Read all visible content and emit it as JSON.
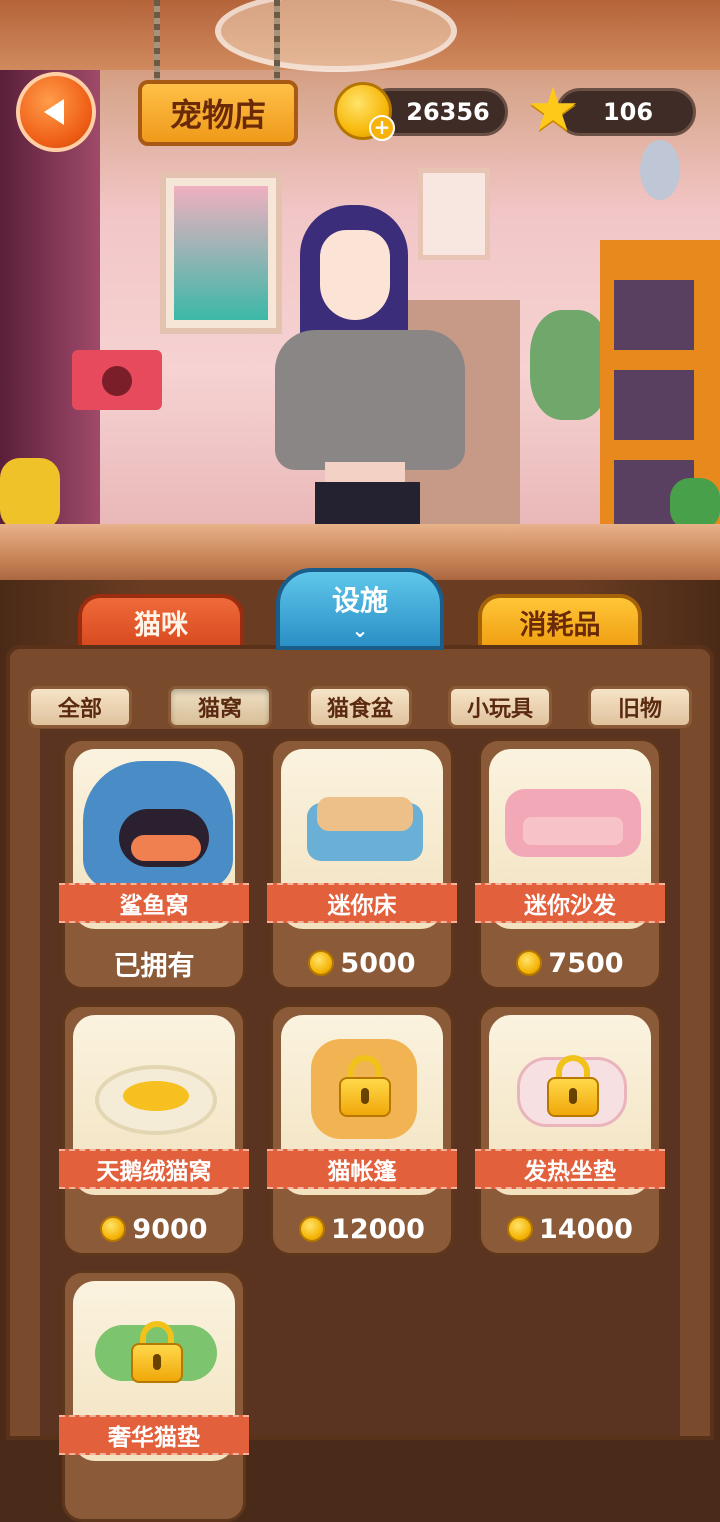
{
  "header": {
    "title": "宠物店",
    "coins": "26356",
    "stars": "106"
  },
  "main_tabs": [
    {
      "label": "猫咪"
    },
    {
      "label": "设施",
      "active": true
    },
    {
      "label": "消耗品"
    }
  ],
  "sub_tabs": [
    {
      "label": "全部"
    },
    {
      "label": "猫窝",
      "active": true
    },
    {
      "label": "猫食盆"
    },
    {
      "label": "小玩具"
    },
    {
      "label": "旧物"
    }
  ],
  "items": [
    {
      "name": "鲨鱼窝",
      "status": "已拥有",
      "locked": false
    },
    {
      "name": "迷你床",
      "price": "5000",
      "locked": false
    },
    {
      "name": "迷你沙发",
      "price": "7500",
      "locked": false
    },
    {
      "name": "天鹅绒猫窝",
      "price": "9000",
      "locked": false
    },
    {
      "name": "猫帐篷",
      "price": "12000",
      "locked": true
    },
    {
      "name": "发热坐垫",
      "price": "14000",
      "locked": true
    },
    {
      "name": "奢华猫垫",
      "locked": true
    }
  ],
  "colors": {
    "back_button": "#ef5e16",
    "title_sign": "#ffc048",
    "tab_cats": "#d84a20",
    "tab_facility": "#2a90c6",
    "tab_consumables": "#f0a012",
    "ribbon": "#e2603c",
    "panel": "#7a4a2c"
  },
  "icons": {
    "back": "back-arrow-icon",
    "coin": "coin-icon",
    "star": "star-icon",
    "lock": "lock-icon",
    "chevron": "chevron-down-icon"
  }
}
